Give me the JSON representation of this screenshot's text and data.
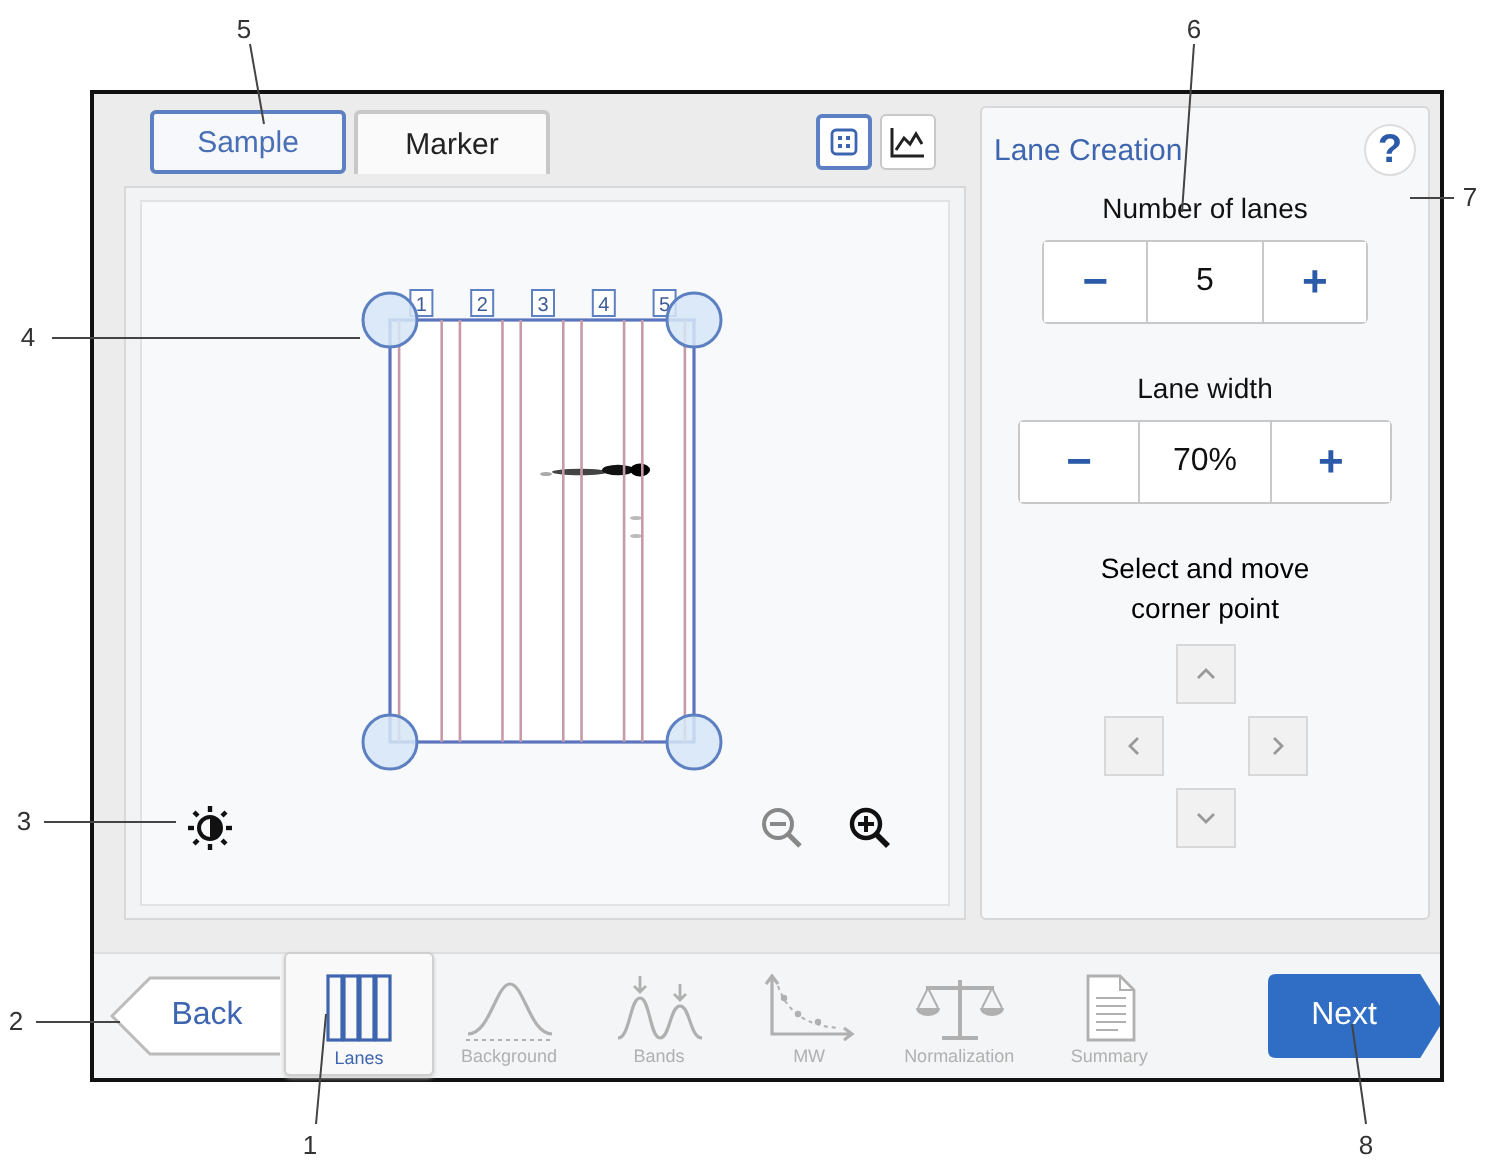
{
  "tabs": [
    {
      "label": "Sample",
      "selected": true
    },
    {
      "label": "Marker",
      "selected": false
    }
  ],
  "view_buttons": [
    {
      "kind": "lanes",
      "selected": true
    },
    {
      "kind": "profile",
      "selected": false
    }
  ],
  "lanes": [
    {
      "label": "1"
    },
    {
      "label": "2"
    },
    {
      "label": "3"
    },
    {
      "label": "4"
    },
    {
      "label": "5"
    }
  ],
  "panel": {
    "title": "Lane Creation",
    "help": "?",
    "number_of_lanes": {
      "label": "Number of lanes",
      "minus": "−",
      "value": "5",
      "plus": "+"
    },
    "lane_width": {
      "label": "Lane width",
      "minus": "−",
      "value": "70%",
      "plus": "+"
    },
    "corner": {
      "label": "Select and move corner point",
      "enabled": false
    }
  },
  "nav": {
    "back": "Back",
    "next": "Next",
    "steps": [
      {
        "label": "Lanes",
        "kind": "lanes",
        "selected": true,
        "disabled": false
      },
      {
        "label": "Background",
        "kind": "background",
        "selected": false,
        "disabled": true
      },
      {
        "label": "Bands",
        "kind": "bands",
        "selected": false,
        "disabled": true
      },
      {
        "label": "MW",
        "kind": "mw",
        "selected": false,
        "disabled": true
      },
      {
        "label": "Normalization",
        "kind": "normalization",
        "selected": false,
        "disabled": true
      },
      {
        "label": "Summary",
        "kind": "summary",
        "selected": false,
        "disabled": true
      }
    ]
  },
  "callouts": [
    {
      "number": "5"
    },
    {
      "number": "6"
    },
    {
      "number": "7"
    },
    {
      "number": "4"
    },
    {
      "number": "3"
    },
    {
      "number": "2"
    },
    {
      "number": "1"
    },
    {
      "number": "8"
    }
  ]
}
